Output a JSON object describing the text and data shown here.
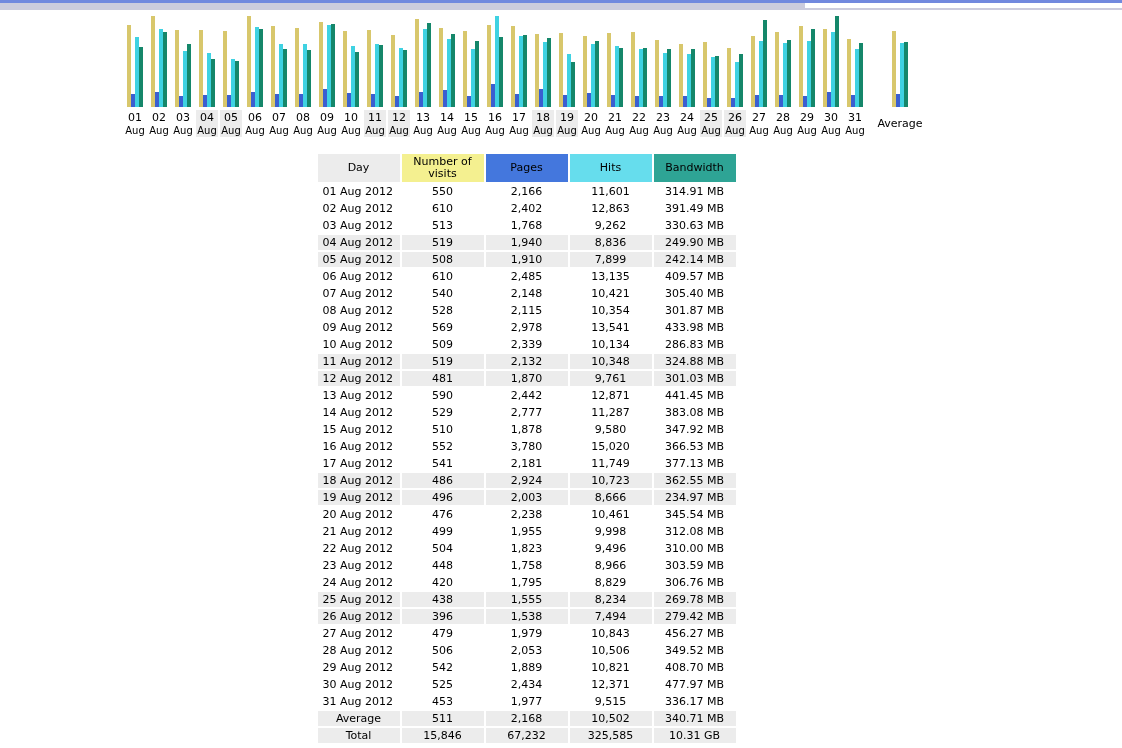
{
  "chart": {
    "columns": [
      {
        "day": "01",
        "month": "Aug",
        "weekend": false
      },
      {
        "day": "02",
        "month": "Aug",
        "weekend": false
      },
      {
        "day": "03",
        "month": "Aug",
        "weekend": false
      },
      {
        "day": "04",
        "month": "Aug",
        "weekend": true
      },
      {
        "day": "05",
        "month": "Aug",
        "weekend": true
      },
      {
        "day": "06",
        "month": "Aug",
        "weekend": false
      },
      {
        "day": "07",
        "month": "Aug",
        "weekend": false
      },
      {
        "day": "08",
        "month": "Aug",
        "weekend": false
      },
      {
        "day": "09",
        "month": "Aug",
        "weekend": false
      },
      {
        "day": "10",
        "month": "Aug",
        "weekend": false
      },
      {
        "day": "11",
        "month": "Aug",
        "weekend": true
      },
      {
        "day": "12",
        "month": "Aug",
        "weekend": true
      },
      {
        "day": "13",
        "month": "Aug",
        "weekend": false
      },
      {
        "day": "14",
        "month": "Aug",
        "weekend": false
      },
      {
        "day": "15",
        "month": "Aug",
        "weekend": false
      },
      {
        "day": "16",
        "month": "Aug",
        "weekend": false
      },
      {
        "day": "17",
        "month": "Aug",
        "weekend": false
      },
      {
        "day": "18",
        "month": "Aug",
        "weekend": true
      },
      {
        "day": "19",
        "month": "Aug",
        "weekend": true
      },
      {
        "day": "20",
        "month": "Aug",
        "weekend": false
      },
      {
        "day": "21",
        "month": "Aug",
        "weekend": false
      },
      {
        "day": "22",
        "month": "Aug",
        "weekend": false
      },
      {
        "day": "23",
        "month": "Aug",
        "weekend": false
      },
      {
        "day": "24",
        "month": "Aug",
        "weekend": false
      },
      {
        "day": "25",
        "month": "Aug",
        "weekend": true
      },
      {
        "day": "26",
        "month": "Aug",
        "weekend": true
      },
      {
        "day": "27",
        "month": "Aug",
        "weekend": false
      },
      {
        "day": "28",
        "month": "Aug",
        "weekend": false
      },
      {
        "day": "29",
        "month": "Aug",
        "weekend": false
      },
      {
        "day": "30",
        "month": "Aug",
        "weekend": false
      },
      {
        "day": "31",
        "month": "Aug",
        "weekend": false
      }
    ],
    "average_label": "Average"
  },
  "table": {
    "columns": [
      {
        "label": "Day",
        "color": "#ececec"
      },
      {
        "label": "Number of visits",
        "color": "#f4f090"
      },
      {
        "label": "Pages",
        "color": "#4477dd"
      },
      {
        "label": "Hits",
        "color": "#66dded"
      },
      {
        "label": "Bandwidth",
        "color": "#2ea495"
      }
    ],
    "rows": [
      {
        "day": "01 Aug 2012",
        "visits": "550",
        "pages": "2,166",
        "hits": "11,601",
        "bandwidth": "314.91 MB",
        "weekend": false
      },
      {
        "day": "02 Aug 2012",
        "visits": "610",
        "pages": "2,402",
        "hits": "12,863",
        "bandwidth": "391.49 MB",
        "weekend": false
      },
      {
        "day": "03 Aug 2012",
        "visits": "513",
        "pages": "1,768",
        "hits": "9,262",
        "bandwidth": "330.63 MB",
        "weekend": false
      },
      {
        "day": "04 Aug 2012",
        "visits": "519",
        "pages": "1,940",
        "hits": "8,836",
        "bandwidth": "249.90 MB",
        "weekend": true
      },
      {
        "day": "05 Aug 2012",
        "visits": "508",
        "pages": "1,910",
        "hits": "7,899",
        "bandwidth": "242.14 MB",
        "weekend": true
      },
      {
        "day": "06 Aug 2012",
        "visits": "610",
        "pages": "2,485",
        "hits": "13,135",
        "bandwidth": "409.57 MB",
        "weekend": false
      },
      {
        "day": "07 Aug 2012",
        "visits": "540",
        "pages": "2,148",
        "hits": "10,421",
        "bandwidth": "305.40 MB",
        "weekend": false
      },
      {
        "day": "08 Aug 2012",
        "visits": "528",
        "pages": "2,115",
        "hits": "10,354",
        "bandwidth": "301.87 MB",
        "weekend": false
      },
      {
        "day": "09 Aug 2012",
        "visits": "569",
        "pages": "2,978",
        "hits": "13,541",
        "bandwidth": "433.98 MB",
        "weekend": false
      },
      {
        "day": "10 Aug 2012",
        "visits": "509",
        "pages": "2,339",
        "hits": "10,134",
        "bandwidth": "286.83 MB",
        "weekend": false
      },
      {
        "day": "11 Aug 2012",
        "visits": "519",
        "pages": "2,132",
        "hits": "10,348",
        "bandwidth": "324.88 MB",
        "weekend": true
      },
      {
        "day": "12 Aug 2012",
        "visits": "481",
        "pages": "1,870",
        "hits": "9,761",
        "bandwidth": "301.03 MB",
        "weekend": true
      },
      {
        "day": "13 Aug 2012",
        "visits": "590",
        "pages": "2,442",
        "hits": "12,871",
        "bandwidth": "441.45 MB",
        "weekend": false
      },
      {
        "day": "14 Aug 2012",
        "visits": "529",
        "pages": "2,777",
        "hits": "11,287",
        "bandwidth": "383.08 MB",
        "weekend": false
      },
      {
        "day": "15 Aug 2012",
        "visits": "510",
        "pages": "1,878",
        "hits": "9,580",
        "bandwidth": "347.92 MB",
        "weekend": false
      },
      {
        "day": "16 Aug 2012",
        "visits": "552",
        "pages": "3,780",
        "hits": "15,020",
        "bandwidth": "366.53 MB",
        "weekend": false
      },
      {
        "day": "17 Aug 2012",
        "visits": "541",
        "pages": "2,181",
        "hits": "11,749",
        "bandwidth": "377.13 MB",
        "weekend": false
      },
      {
        "day": "18 Aug 2012",
        "visits": "486",
        "pages": "2,924",
        "hits": "10,723",
        "bandwidth": "362.55 MB",
        "weekend": true
      },
      {
        "day": "19 Aug 2012",
        "visits": "496",
        "pages": "2,003",
        "hits": "8,666",
        "bandwidth": "234.97 MB",
        "weekend": true
      },
      {
        "day": "20 Aug 2012",
        "visits": "476",
        "pages": "2,238",
        "hits": "10,461",
        "bandwidth": "345.54 MB",
        "weekend": false
      },
      {
        "day": "21 Aug 2012",
        "visits": "499",
        "pages": "1,955",
        "hits": "9,998",
        "bandwidth": "312.08 MB",
        "weekend": false
      },
      {
        "day": "22 Aug 2012",
        "visits": "504",
        "pages": "1,823",
        "hits": "9,496",
        "bandwidth": "310.00 MB",
        "weekend": false
      },
      {
        "day": "23 Aug 2012",
        "visits": "448",
        "pages": "1,758",
        "hits": "8,966",
        "bandwidth": "303.59 MB",
        "weekend": false
      },
      {
        "day": "24 Aug 2012",
        "visits": "420",
        "pages": "1,795",
        "hits": "8,829",
        "bandwidth": "306.76 MB",
        "weekend": false
      },
      {
        "day": "25 Aug 2012",
        "visits": "438",
        "pages": "1,555",
        "hits": "8,234",
        "bandwidth": "269.78 MB",
        "weekend": true
      },
      {
        "day": "26 Aug 2012",
        "visits": "396",
        "pages": "1,538",
        "hits": "7,494",
        "bandwidth": "279.42 MB",
        "weekend": true
      },
      {
        "day": "27 Aug 2012",
        "visits": "479",
        "pages": "1,979",
        "hits": "10,843",
        "bandwidth": "456.27 MB",
        "weekend": false
      },
      {
        "day": "28 Aug 2012",
        "visits": "506",
        "pages": "2,053",
        "hits": "10,506",
        "bandwidth": "349.52 MB",
        "weekend": false
      },
      {
        "day": "29 Aug 2012",
        "visits": "542",
        "pages": "1,889",
        "hits": "10,821",
        "bandwidth": "408.70 MB",
        "weekend": false
      },
      {
        "day": "30 Aug 2012",
        "visits": "525",
        "pages": "2,434",
        "hits": "12,371",
        "bandwidth": "477.97 MB",
        "weekend": false
      },
      {
        "day": "31 Aug 2012",
        "visits": "453",
        "pages": "1,977",
        "hits": "9,515",
        "bandwidth": "336.17 MB",
        "weekend": false
      }
    ],
    "summary_rows": [
      {
        "label": "Average",
        "visits": "511",
        "pages": "2,168",
        "hits": "10,502",
        "bandwidth": "340.71 MB"
      },
      {
        "label": "Total",
        "visits": "15,846",
        "pages": "67,232",
        "hits": "325,585",
        "bandwidth": "10.31 GB"
      }
    ]
  }
}
